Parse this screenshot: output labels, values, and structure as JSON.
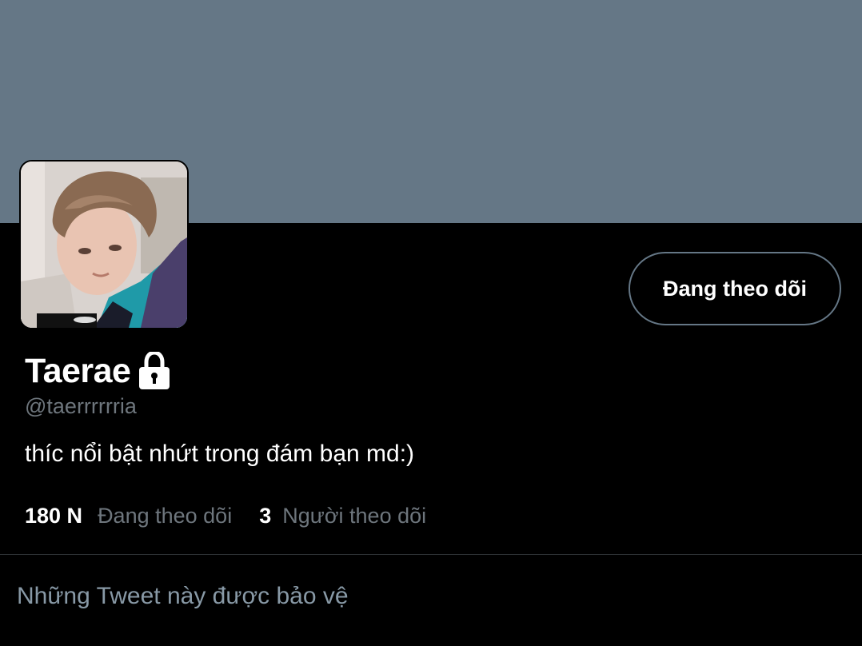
{
  "colors": {
    "banner": "#657786",
    "background": "#000000",
    "secondary_text": "#6e767d",
    "protected_text": "#8899a6",
    "button_border": "#657786"
  },
  "profile": {
    "display_name": "Taerae",
    "handle": "@taerrrrrria",
    "bio": "thíc nổi bật nhứt trong đám bạn md:)",
    "lock_icon": "lock-icon",
    "avatar": "profile-photo"
  },
  "follow_button": {
    "label": "Đang theo dõi"
  },
  "stats": {
    "following_count": "180 N",
    "following_label": "Đang theo dõi",
    "followers_count": "3",
    "followers_label": "Người theo dõi"
  },
  "protected_message": "Những Tweet này được bảo vệ"
}
